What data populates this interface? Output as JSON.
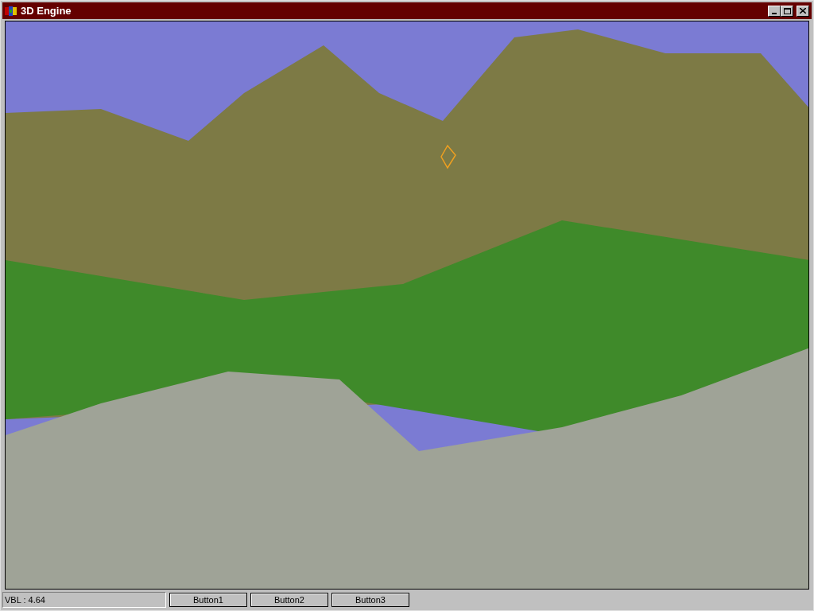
{
  "window": {
    "title": "3D Engine"
  },
  "status_bar": {
    "readout": "VBL : 4.64",
    "buttons": [
      "Button1",
      "Button2",
      "Button3"
    ]
  }
}
